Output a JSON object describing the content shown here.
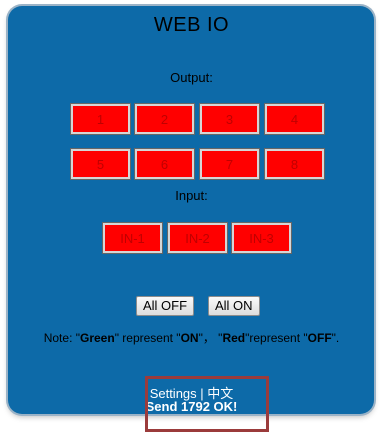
{
  "title": "WEB IO",
  "output": {
    "label": "Output:",
    "buttons": [
      "1",
      "2",
      "3",
      "4",
      "5",
      "6",
      "7",
      "8"
    ]
  },
  "input": {
    "label": "Input:",
    "buttons": [
      "IN-1",
      "IN-2",
      "IN-3"
    ]
  },
  "controls": {
    "all_off": "All OFF",
    "all_on": "All ON"
  },
  "note": {
    "prefix": "Note: \"",
    "green": "Green",
    "mid1": "\" represent \"",
    "on": "ON",
    "mid2": "\"，  \"",
    "red": "Red",
    "mid3": "\"represent \"",
    "off": "OFF",
    "suffix": "\"."
  },
  "footer": {
    "settings": "Settings",
    "separator": " | ",
    "language": "中文",
    "status": "Send 1792 OK!"
  },
  "colors": {
    "panel": "#0d6aa8",
    "button_off": "#ff0000",
    "highlight_box": "#9b3b3b"
  }
}
